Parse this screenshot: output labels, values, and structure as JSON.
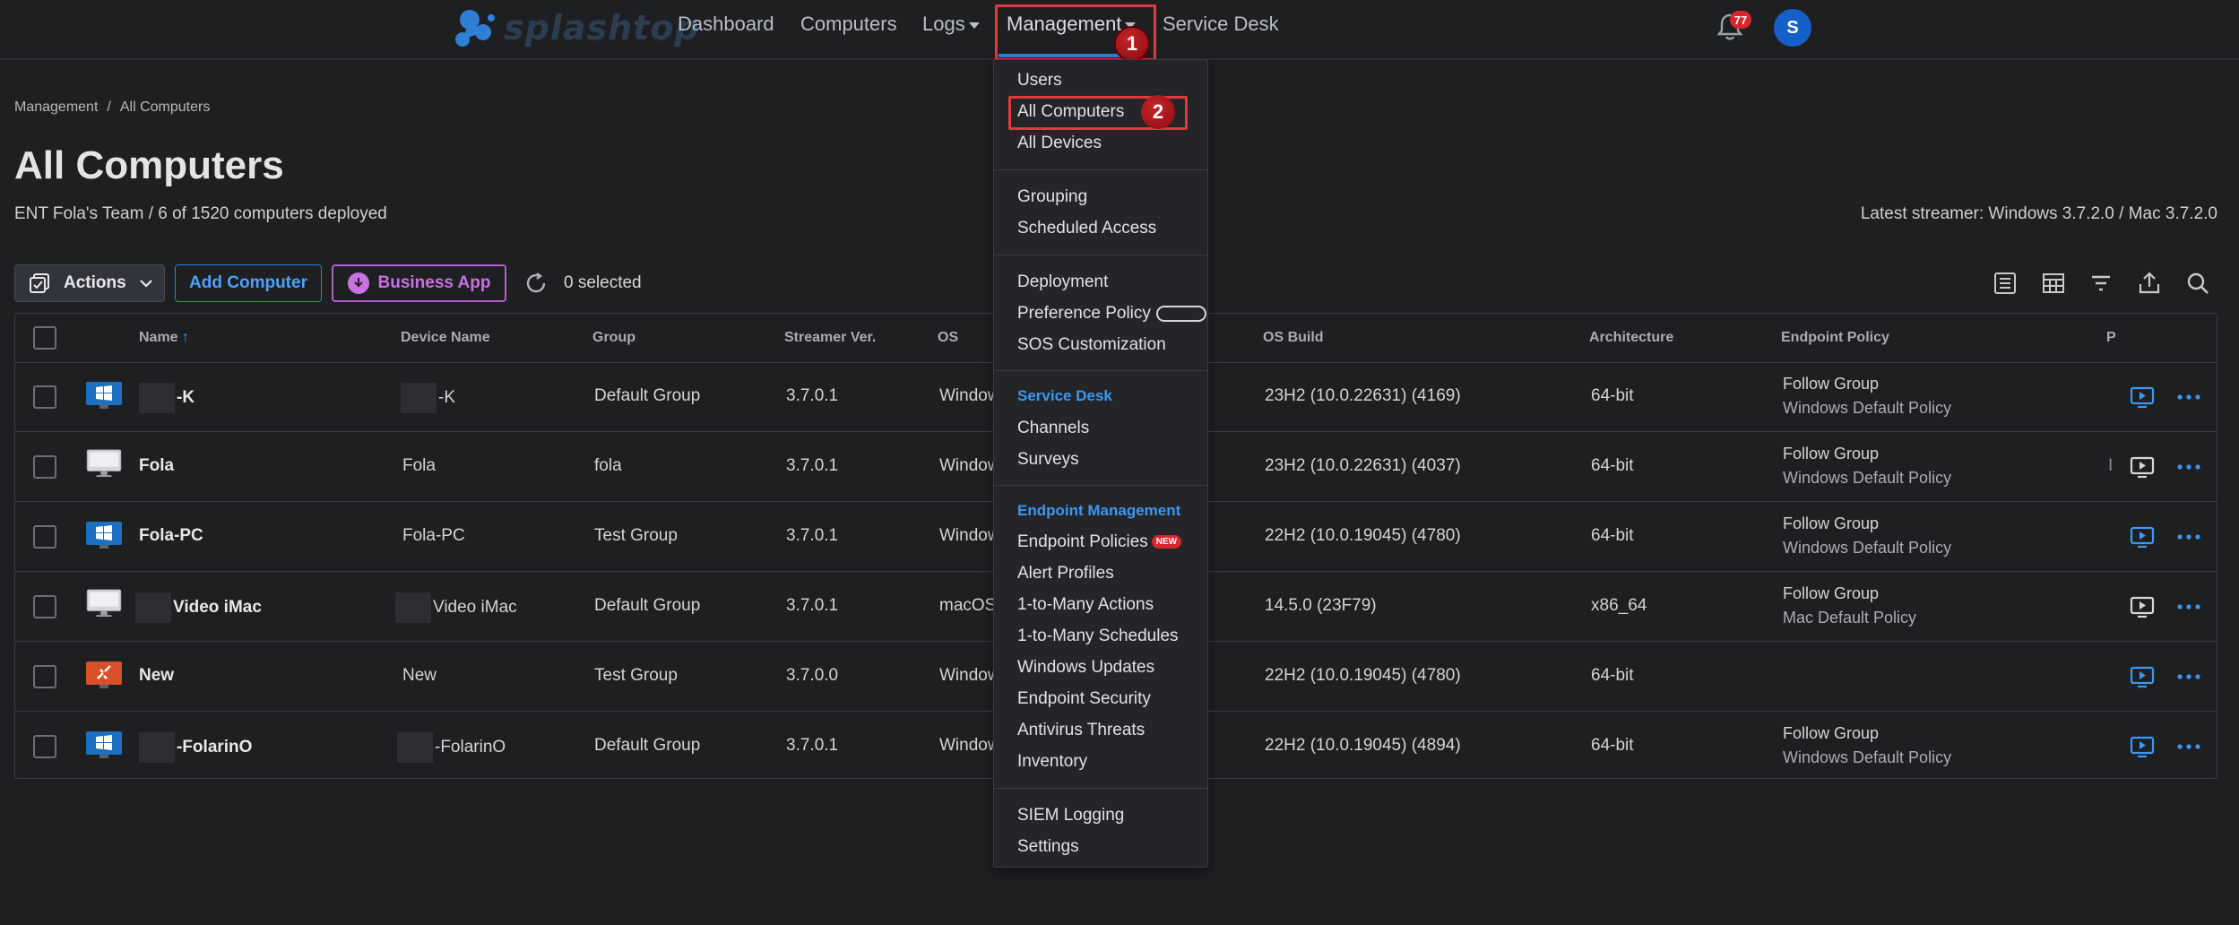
{
  "brand": {
    "name": "splashtop"
  },
  "nav": {
    "dashboard": "Dashboard",
    "computers": "Computers",
    "logs": "Logs",
    "management": "Management",
    "service_desk": "Service Desk",
    "notification_count": "77",
    "avatar_initial": "S"
  },
  "steps": {
    "one": "1",
    "two": "2"
  },
  "breadcrumb": {
    "root": "Management",
    "sep": "/",
    "current": "All Computers"
  },
  "page": {
    "title": "All Computers",
    "subtitle": "ENT Fola's Team / 6 of 1520 computers deployed",
    "latest_streamer": "Latest streamer: Windows 3.7.2.0 / Mac 3.7.2.0"
  },
  "toolbar": {
    "actions": "Actions",
    "add_computer": "Add Computer",
    "business_app": "Business App",
    "selected": "0 selected"
  },
  "table": {
    "headers": {
      "name": "Name",
      "sort_arrow": "↑",
      "device_name": "Device Name",
      "group": "Group",
      "streamer_ver": "Streamer Ver.",
      "os": "OS",
      "os_build": "OS Build",
      "architecture": "Architecture",
      "endpoint_policy": "Endpoint Policy",
      "truncated": "P"
    },
    "rows": [
      {
        "os_icon": "windows-icon",
        "name": "-K",
        "device": "-K",
        "group": "Default Group",
        "ver": "3.7.0.1",
        "os": "Window",
        "build": "23H2 (10.0.22631) (4169)",
        "arch": "64-bit",
        "policy1": "Follow Group",
        "policy2": "Windows Default Policy",
        "extra": ""
      },
      {
        "os_icon": "imac-icon",
        "name": "Fola",
        "device": "Fola",
        "group": "fola",
        "ver": "3.7.0.1",
        "os": "Window",
        "build": "23H2 (10.0.22631) (4037)",
        "arch": "64-bit",
        "policy1": "Follow Group",
        "policy2": "Windows Default Policy",
        "extra": "I"
      },
      {
        "os_icon": "windows-icon",
        "name": "Fola-PC",
        "device": "Fola-PC",
        "group": "Test Group",
        "ver": "3.7.0.1",
        "os": "Window",
        "build": "22H2 (10.0.19045) (4780)",
        "arch": "64-bit",
        "policy1": "Follow Group",
        "policy2": "Windows Default Policy",
        "extra": ""
      },
      {
        "os_icon": "imac-icon",
        "name": "Video iMac",
        "device": "Video iMac",
        "group": "Default Group",
        "ver": "3.7.0.1",
        "os": "macOS",
        "build": "14.5.0 (23F79)",
        "arch": "x86_64",
        "policy1": "Follow Group",
        "policy2": "Mac Default Policy",
        "extra": ""
      },
      {
        "os_icon": "disconnected-icon",
        "name": "New",
        "device": "New",
        "group": "Test Group",
        "ver": "3.7.0.0",
        "os": "Window",
        "build": "22H2 (10.0.19045) (4780)",
        "arch": "64-bit",
        "policy1": "",
        "policy2": "",
        "extra": ""
      },
      {
        "os_icon": "windows-icon",
        "name": "-FolarinO",
        "device": "-FolarinO",
        "group": "Default Group",
        "ver": "3.7.0.1",
        "os": "Window",
        "build": "22H2 (10.0.19045) (4894)",
        "arch": "64-bit",
        "policy1": "Follow Group",
        "policy2": "Windows Default Policy",
        "extra": ""
      }
    ]
  },
  "menu": {
    "users": "Users",
    "all_computers": "All Computers",
    "all_devices": "All Devices",
    "grouping": "Grouping",
    "scheduled_access": "Scheduled Access",
    "deployment": "Deployment",
    "preference_policy": "Preference Policy",
    "sos_customization": "SOS Customization",
    "service_desk_section": "Service Desk",
    "channels": "Channels",
    "surveys": "Surveys",
    "endpoint_mgmt_section": "Endpoint Management",
    "endpoint_policies": "Endpoint Policies",
    "new_badge": "NEW",
    "alert_profiles": "Alert Profiles",
    "one_to_many_actions": "1-to-Many Actions",
    "one_to_many_schedules": "1-to-Many Schedules",
    "windows_updates": "Windows Updates",
    "endpoint_security": "Endpoint Security",
    "antivirus_threats": "Antivirus Threats",
    "inventory": "Inventory",
    "siem_logging": "SIEM Logging",
    "settings": "Settings"
  },
  "colors": {
    "accent": "#2f7fd6",
    "highlight": "#e03a3e",
    "business": "#c872e0"
  }
}
